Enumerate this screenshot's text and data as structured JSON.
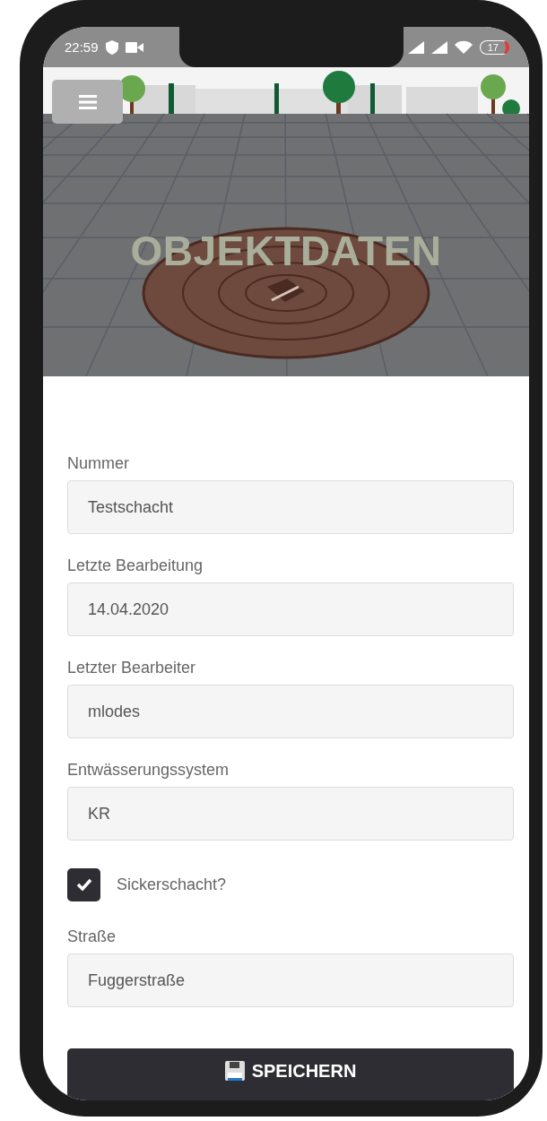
{
  "status_bar": {
    "time": "22:59",
    "battery": "17"
  },
  "hero": {
    "title": "OBJEKTDATEN"
  },
  "form": [
    {
      "kind": "field",
      "label": "Nummer",
      "value": "Testschacht"
    },
    {
      "kind": "field",
      "label": "Letzte Bearbeitung",
      "value": "14.04.2020"
    },
    {
      "kind": "field",
      "label": "Letzter Bearbeiter",
      "value": "mlodes"
    },
    {
      "kind": "field",
      "label": "Entwässerungssystem",
      "value": "KR"
    },
    {
      "kind": "checkbox",
      "label": "Sickerschacht?",
      "checked": true
    },
    {
      "kind": "field",
      "label": "Straße",
      "value": "Fuggerstraße"
    }
  ],
  "save_button": {
    "label": "SPEICHERN"
  }
}
